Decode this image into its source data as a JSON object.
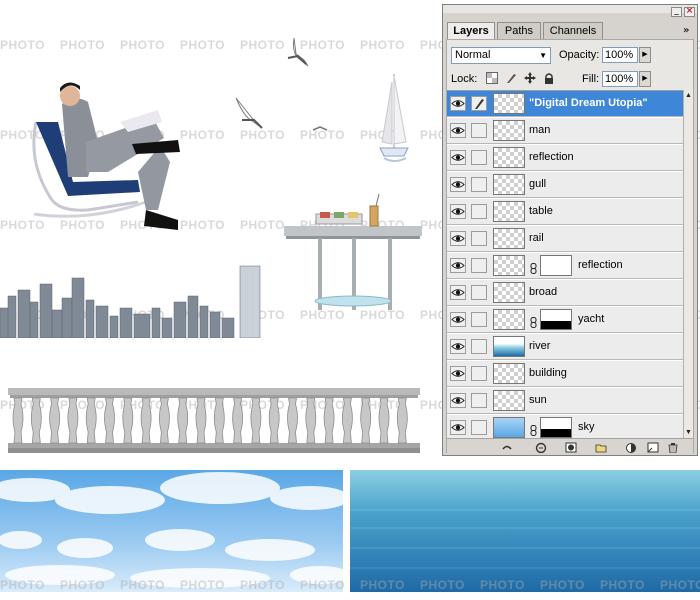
{
  "watermark": "PHOTO",
  "panel": {
    "tabs": [
      "Layers",
      "Paths",
      "Channels"
    ],
    "blend_mode": "Normal",
    "opacity_label": "Opacity:",
    "opacity_value": "100%",
    "lock_label": "Lock:",
    "fill_label": "Fill:",
    "fill_value": "100%",
    "layers": [
      {
        "name": "\"Digital Dream Utopia\"",
        "thumb": "checker",
        "selected": true,
        "mask": false
      },
      {
        "name": "man",
        "thumb": "checker",
        "selected": false,
        "mask": false
      },
      {
        "name": "reflection",
        "thumb": "checker",
        "selected": false,
        "mask": false
      },
      {
        "name": "gull",
        "thumb": "checker",
        "selected": false,
        "mask": false
      },
      {
        "name": "table",
        "thumb": "checker",
        "selected": false,
        "mask": false
      },
      {
        "name": "rail",
        "thumb": "checker",
        "selected": false,
        "mask": false
      },
      {
        "name": "reflection",
        "thumb": "checker",
        "selected": false,
        "mask": true
      },
      {
        "name": "broad",
        "thumb": "checker",
        "selected": false,
        "mask": false
      },
      {
        "name": "yacht",
        "thumb": "checker",
        "selected": false,
        "mask": true
      },
      {
        "name": "river",
        "thumb": "river",
        "selected": false,
        "mask": false
      },
      {
        "name": "building",
        "thumb": "checker",
        "selected": false,
        "mask": false
      },
      {
        "name": "sun",
        "thumb": "checker",
        "selected": false,
        "mask": false
      },
      {
        "name": "sky",
        "thumb": "sky",
        "selected": false,
        "mask": true
      }
    ],
    "bottom_icons": [
      "link-layers-icon",
      "layer-style-icon",
      "add-mask-icon",
      "new-group-icon",
      "adjustment-layer-icon",
      "new-layer-icon",
      "delete-layer-icon"
    ]
  },
  "colors": {
    "selection": "#3d86d8",
    "sky_top": "#5aa7e6",
    "sea": "#3f8fc4"
  }
}
